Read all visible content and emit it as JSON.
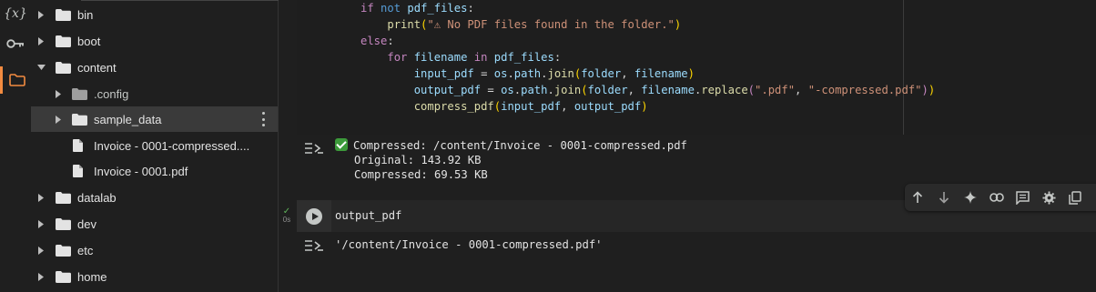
{
  "rail": {
    "items": [
      {
        "name": "variables",
        "label": "{x}"
      },
      {
        "name": "secrets",
        "icon": "key-icon"
      },
      {
        "name": "files",
        "icon": "folder-icon",
        "active": true
      }
    ],
    "accent": "#f28b40"
  },
  "tree": {
    "items": [
      {
        "label": "bin"
      },
      {
        "label": "boot"
      },
      {
        "label": "content",
        "expanded": true
      },
      {
        "label": ".config"
      },
      {
        "label": "sample_data",
        "selected": true
      },
      {
        "label": "Invoice - 0001-compressed...."
      },
      {
        "label": "Invoice - 0001.pdf"
      },
      {
        "label": "datalab"
      },
      {
        "label": "dev"
      },
      {
        "label": "etc"
      },
      {
        "label": "home"
      }
    ]
  },
  "code": {
    "lines": [
      "if not pdf_files:",
      "    print(\"⚠ No PDF files found in the folder.\")",
      "else:",
      "    for filename in pdf_files:",
      "        input_pdf = os.path.join(folder, filename)",
      "        output_pdf = os.path.join(folder, filename.replace(\".pdf\", \"-compressed.pdf\"))",
      "        compress_pdf(input_pdf, output_pdf)"
    ]
  },
  "output1": {
    "line1": "Compressed: /content/Invoice - 0001-compressed.pdf",
    "line2": "Original: 143.92 KB",
    "line3": "Compressed: 69.53 KB",
    "status_color": "#3c9a3a"
  },
  "toolbar": {
    "buttons": [
      "arrow-up-icon",
      "arrow-down-icon",
      "sparkle-icon",
      "link-icon",
      "comment-icon",
      "gear-icon",
      "copy-icon",
      "more-icon"
    ]
  },
  "cell2": {
    "code": "output_pdf",
    "exec_time": "0s",
    "output": "'/content/Invoice - 0001-compressed.pdf'"
  }
}
